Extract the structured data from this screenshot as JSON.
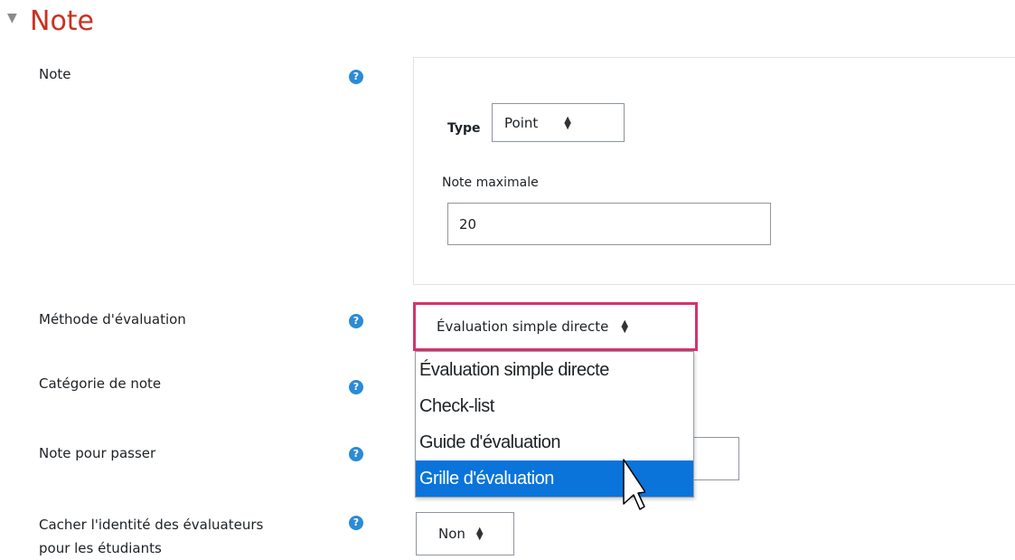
{
  "section": {
    "toggle_icon": "collapse-triangle-icon",
    "title": "Note"
  },
  "grade": {
    "label": "Note",
    "type_label": "Type",
    "type_value": "Point",
    "max_label": "Note maximale",
    "max_value": "20"
  },
  "method": {
    "label": "Méthode d'évaluation",
    "value": "Évaluation simple directe",
    "options": [
      "Évaluation simple directe",
      "Check-list",
      "Guide d'évaluation",
      "Grille d'évaluation"
    ],
    "hovered_index": 3,
    "highlight_color": "#d6336c"
  },
  "category": {
    "label": "Catégorie de note"
  },
  "pass": {
    "label": "Note pour passer"
  },
  "hide_identity": {
    "label_line1": "Cacher l'identité des évaluateurs",
    "label_line2": "pour les étudiants",
    "value": "Non"
  },
  "colors": {
    "title": "#ca3120",
    "help": "#2b8bd5",
    "selected_option": "#0a74da"
  }
}
